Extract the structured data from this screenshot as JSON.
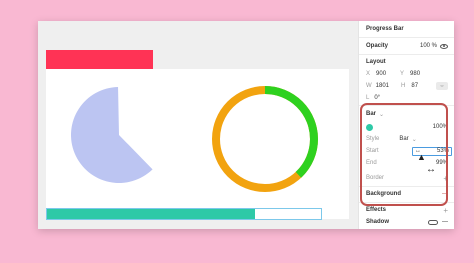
{
  "colors": {
    "red_bar": "#ff3355",
    "pie": "#bcc5f2",
    "ring_orange": "#f2a30f",
    "ring_green": "#2ed11f",
    "progress_fill": "#2ec9a7",
    "bar_color": "#2ec9a7"
  },
  "canvas": {
    "pie_fraction": 0.62,
    "ring_green_fraction": 0.38,
    "progress_fraction": 0.76
  },
  "panel": {
    "title": "Progress Bar",
    "opacity_label": "Opacity",
    "opacity_value": "100 %",
    "layout_label": "Layout",
    "x_label": "X",
    "x_value": "900",
    "y_label": "Y",
    "y_value": "980",
    "w_label": "W",
    "w_value": "1801",
    "h_label": "H",
    "h_value": "87",
    "rotation_label": "L",
    "rotation_value": "0°",
    "bar_section": "Bar",
    "bar_percent": "100%",
    "style_label": "Style",
    "style_value": "Bar",
    "start_label": "Start",
    "start_value": "53%",
    "end_label": "End",
    "end_value": "99%",
    "border_label": "Border",
    "background_label": "Background",
    "effects_label": "Effects",
    "shadow_label": "Shadow",
    "plus": "+",
    "minus": "—",
    "link_icon_glyph": "⇔",
    "chevron": "⌄",
    "resize_glyph": "↔"
  }
}
